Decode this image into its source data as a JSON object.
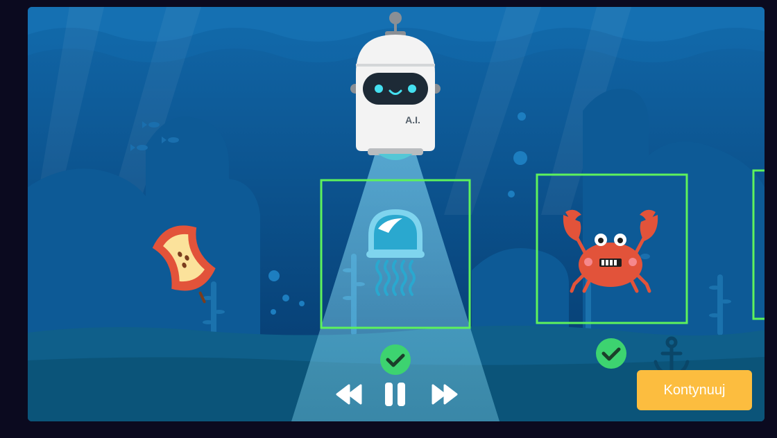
{
  "robot": {
    "label": "A.I.",
    "icon": "robot-icon"
  },
  "items": [
    {
      "name": "apple-core",
      "icon": "apple-core-icon",
      "status": "none"
    },
    {
      "name": "jellyfish",
      "icon": "jellyfish-icon",
      "status": "detected"
    },
    {
      "name": "crab",
      "icon": "crab-icon",
      "status": "detected"
    }
  ],
  "controls": {
    "rewind": "rewind-icon",
    "pause": "pause-icon",
    "fast_forward": "fast-forward-icon"
  },
  "continue_label": "Kontynuuj",
  "colors": {
    "water_top": "#0f5ea0",
    "water_bottom": "#063a6e",
    "highlight_frame": "#5ef25c",
    "check": "#3dd370",
    "continue_button": "#fcbd3f"
  }
}
